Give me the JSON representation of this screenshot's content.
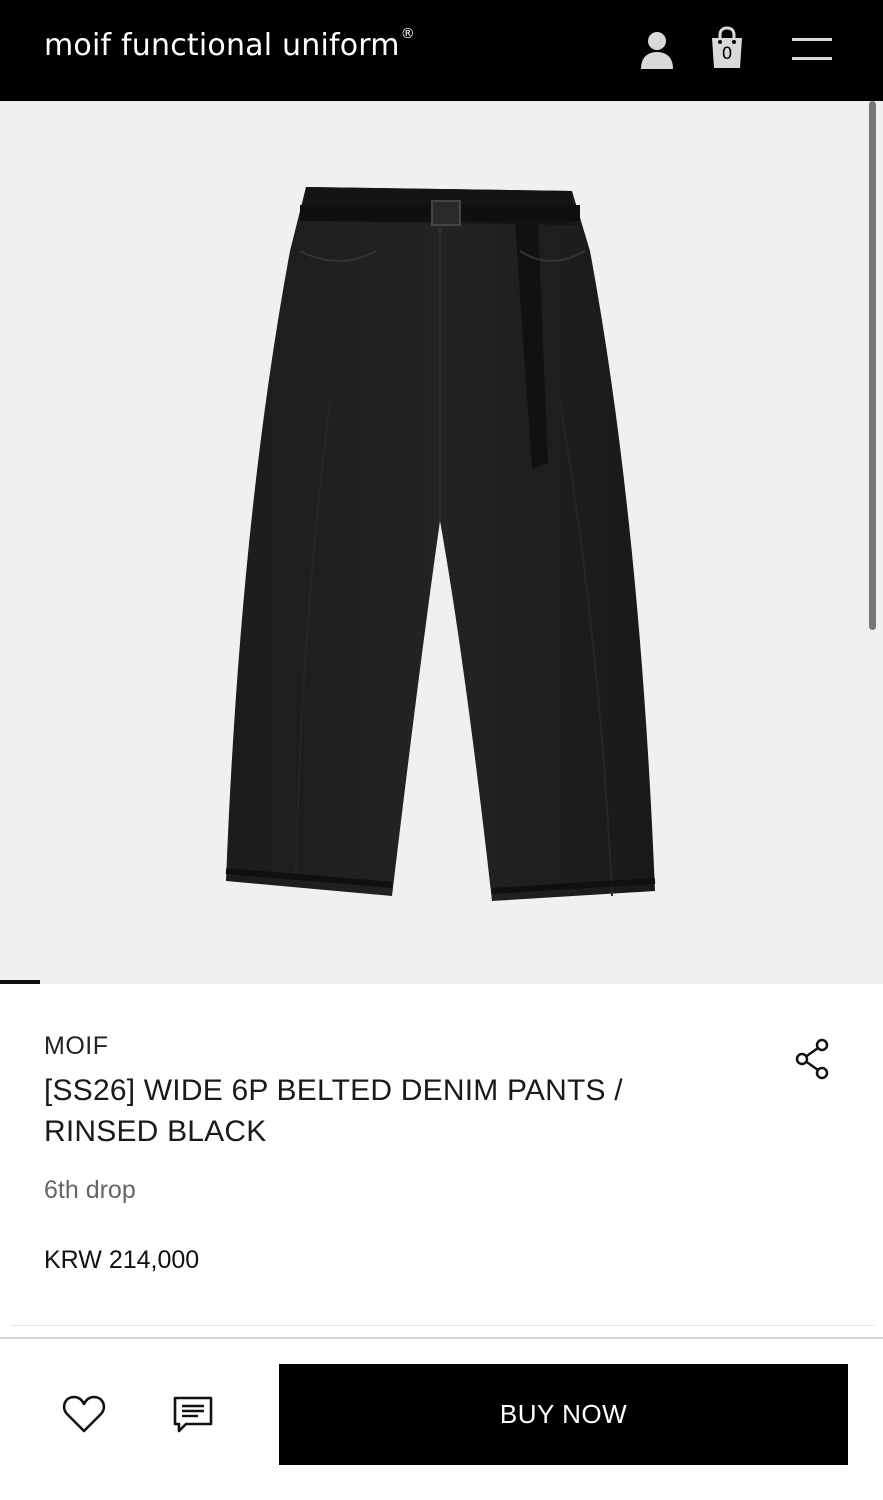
{
  "header": {
    "brand": "moif functional uniform",
    "registered_mark": "®",
    "cart_count": "0",
    "icons": [
      "user-icon",
      "shopping-bag-icon",
      "hamburger-menu-icon"
    ]
  },
  "product": {
    "image_alt_icon": "wide-belted-denim-pants-image",
    "brand": "MOIF",
    "title": "[SS26] WIDE 6P BELTED DENIM PANTS / RINSED BLACK",
    "subtitle": "6th drop",
    "price": "KRW 214,000"
  },
  "actions": {
    "wishlist_icon": "heart-icon",
    "review_icon": "chat-icon",
    "share_icon": "share-icon",
    "buy_label": "BUY NOW"
  },
  "colors": {
    "header_bg": "#000000",
    "hero_bg": "#f0f0f0",
    "buy_button_bg": "#000000"
  }
}
